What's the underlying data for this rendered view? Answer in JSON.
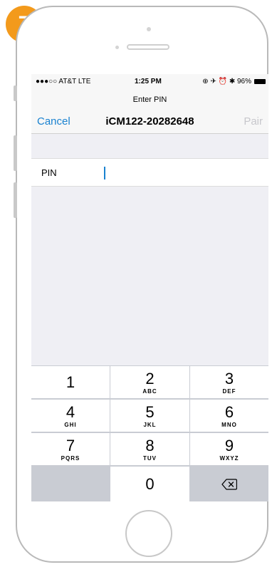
{
  "step_badge": "7",
  "status_bar": {
    "carrier": "●●●○○ AT&T  LTE",
    "time": "1:25 PM",
    "indicators": "⊕ ✈ ⏰ ✱ 96%"
  },
  "nav": {
    "prompt": "Enter PIN",
    "cancel_label": "Cancel",
    "title": "iCM122-20282648",
    "pair_label": "Pair"
  },
  "pin_field": {
    "label": "PIN",
    "value": ""
  },
  "keypad": {
    "keys": [
      {
        "num": "1",
        "letters": ""
      },
      {
        "num": "2",
        "letters": "ABC"
      },
      {
        "num": "3",
        "letters": "DEF"
      },
      {
        "num": "4",
        "letters": "GHI"
      },
      {
        "num": "5",
        "letters": "JKL"
      },
      {
        "num": "6",
        "letters": "MNO"
      },
      {
        "num": "7",
        "letters": "PQRS"
      },
      {
        "num": "8",
        "letters": "TUV"
      },
      {
        "num": "9",
        "letters": "WXYZ"
      },
      {
        "num": "0",
        "letters": ""
      }
    ],
    "delete_icon": "backspace-icon"
  },
  "colors": {
    "accent": "#1a82d0",
    "badge": "#f39a1c",
    "disabled": "#c7c7cc",
    "keypad_bg": "#c9ccd3"
  }
}
